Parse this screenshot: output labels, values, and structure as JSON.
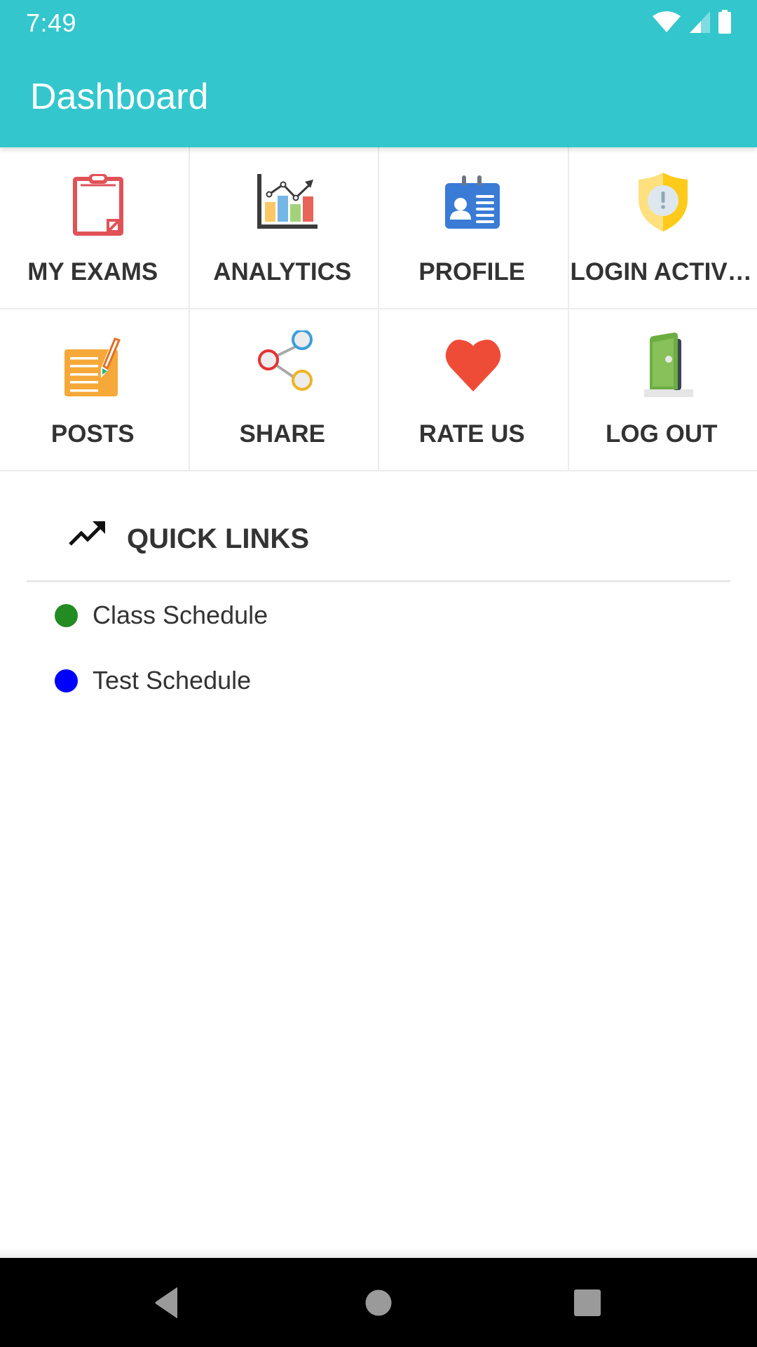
{
  "status_bar": {
    "time": "7:49",
    "icons": [
      "wifi-icon",
      "cellular-signal-icon",
      "battery-icon"
    ]
  },
  "app_bar": {
    "title": "Dashboard",
    "background_color": "#33c6cd"
  },
  "menu_grid": {
    "items": [
      {
        "label": "MY EXAMS",
        "icon": "clipboard-icon"
      },
      {
        "label": "ANALYTICS",
        "icon": "bar-chart-icon"
      },
      {
        "label": "PROFILE",
        "icon": "id-card-icon"
      },
      {
        "label": "LOGIN ACTIVITY",
        "display_label": "LOGIN ACTIVI…",
        "icon": "shield-alert-icon"
      },
      {
        "label": "POSTS",
        "icon": "note-pencil-icon"
      },
      {
        "label": "SHARE",
        "icon": "share-icon"
      },
      {
        "label": "RATE US",
        "icon": "heart-icon"
      },
      {
        "label": "LOG OUT",
        "icon": "door-icon"
      }
    ]
  },
  "quick_links": {
    "title": "QUICK LINKS",
    "icon": "trending-up-icon",
    "items": [
      {
        "label": "Class Schedule",
        "dot_color": "#228b22"
      },
      {
        "label": "Test Schedule",
        "dot_color": "#0000ff"
      }
    ]
  },
  "nav_bar": {
    "buttons": [
      "back",
      "home",
      "recents"
    ]
  }
}
